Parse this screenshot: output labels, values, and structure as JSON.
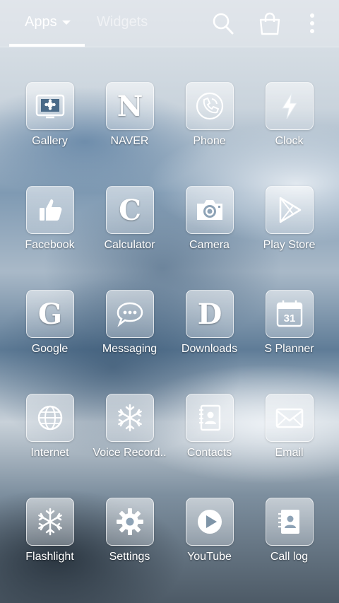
{
  "header": {
    "tabs": [
      {
        "label": "Apps",
        "active": true
      },
      {
        "label": "Widgets",
        "active": false
      }
    ],
    "icons": [
      "search-icon",
      "store-bag-icon",
      "overflow-menu-icon"
    ]
  },
  "apps": [
    {
      "label": "Gallery",
      "icon": "gallery-icon"
    },
    {
      "label": "NAVER",
      "icon": "naver-icon",
      "glyph": "N"
    },
    {
      "label": "Phone",
      "icon": "phone-icon"
    },
    {
      "label": "Clock",
      "icon": "clock-icon"
    },
    {
      "label": "Facebook",
      "icon": "thumbs-up-icon"
    },
    {
      "label": "Calculator",
      "icon": "calculator-icon",
      "glyph": "C"
    },
    {
      "label": "Camera",
      "icon": "camera-icon"
    },
    {
      "label": "Play Store",
      "icon": "play-store-icon"
    },
    {
      "label": "Google",
      "icon": "google-icon",
      "glyph": "G"
    },
    {
      "label": "Messaging",
      "icon": "messaging-icon"
    },
    {
      "label": "Downloads",
      "icon": "downloads-icon",
      "glyph": "D"
    },
    {
      "label": "S Planner",
      "icon": "calendar-icon",
      "glyph": "31"
    },
    {
      "label": "Internet",
      "icon": "globe-icon"
    },
    {
      "label": "Voice Record..",
      "icon": "snowflake-icon"
    },
    {
      "label": "Contacts",
      "icon": "contacts-icon"
    },
    {
      "label": "Email",
      "icon": "envelope-icon"
    },
    {
      "label": "Flashlight",
      "icon": "snowflake-icon"
    },
    {
      "label": "Settings",
      "icon": "gear-icon"
    },
    {
      "label": "YouTube",
      "icon": "play-button-icon"
    },
    {
      "label": "Call log",
      "icon": "call-log-icon"
    }
  ]
}
